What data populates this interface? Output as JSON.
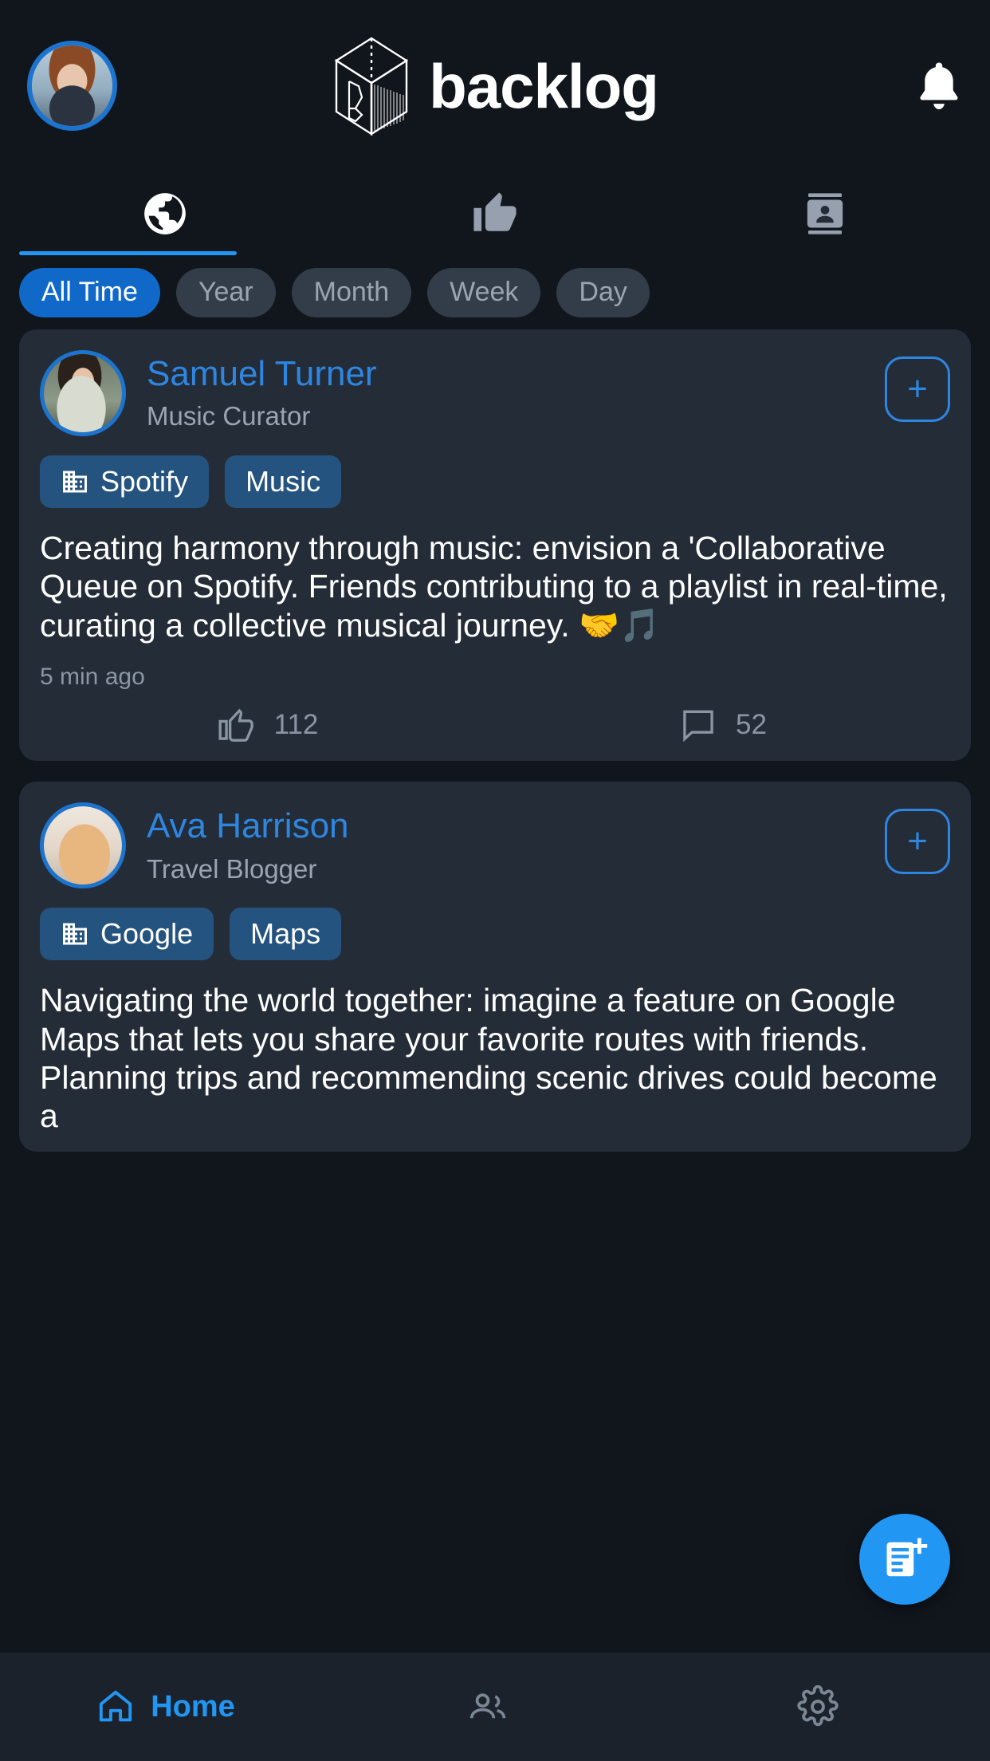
{
  "app": {
    "brand_name": "backlog",
    "accent": "#2196f3",
    "accent_dark": "#1069c9",
    "bg": "#11161d",
    "card_bg": "#242c38"
  },
  "header": {
    "user_avatar_alt": "user-avatar",
    "logo_icon": "cube-logo-icon",
    "bell_icon": "notification-bell-icon"
  },
  "top_tabs": [
    {
      "name": "globe",
      "icon": "globe-icon",
      "active": true
    },
    {
      "name": "likes",
      "icon": "thumbs-up-icon",
      "active": false
    },
    {
      "name": "contacts",
      "icon": "contact-card-icon",
      "active": false
    }
  ],
  "filters": {
    "selected": "All Time",
    "options": [
      "All Time",
      "Year",
      "Month",
      "Week",
      "Day"
    ]
  },
  "feed": [
    {
      "author": "Samuel Turner",
      "role": "Music Curator",
      "avatar_class": "av-sam",
      "add_label": "+",
      "tags": [
        {
          "label": "Spotify",
          "icon": "company-building-icon"
        },
        {
          "label": "Music",
          "icon": ""
        }
      ],
      "text": "Creating harmony through music: envision a 'Collaborative Queue on Spotify. Friends contributing to a playlist in real-time, curating a collective musical journey. 🤝🎵",
      "timestamp": "5 min ago",
      "likes": "112",
      "comments": "52"
    },
    {
      "author": "Ava Harrison",
      "role": "Travel Blogger",
      "avatar_class": "av-ava",
      "add_label": "+",
      "tags": [
        {
          "label": "Google",
          "icon": "company-building-icon"
        },
        {
          "label": "Maps",
          "icon": ""
        }
      ],
      "text": "Navigating the world together: imagine a feature on Google Maps that lets you share your favorite routes with friends. Planning trips and recommending scenic drives could become a",
      "timestamp": "",
      "likes": "",
      "comments": ""
    }
  ],
  "fab": {
    "icon": "new-post-icon"
  },
  "bottom_nav": [
    {
      "label": "Home",
      "icon": "home-icon",
      "active": true
    },
    {
      "label": "",
      "icon": "people-icon",
      "active": false
    },
    {
      "label": "",
      "icon": "gear-icon",
      "active": false
    }
  ]
}
